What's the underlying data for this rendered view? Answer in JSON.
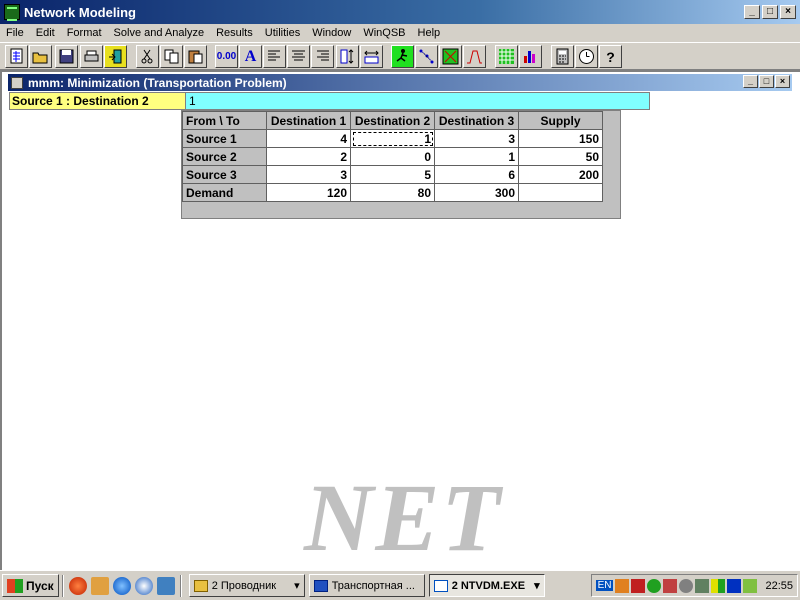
{
  "app": {
    "title": "Network Modeling"
  },
  "menu": [
    "File",
    "Edit",
    "Format",
    "Solve and Analyze",
    "Results",
    "Utilities",
    "Window",
    "WinQSB",
    "Help"
  ],
  "toolbar": {
    "icons": [
      "new-problem-icon",
      "open-icon",
      "save-icon",
      "print-icon",
      "exit-icon",
      "cut-icon",
      "copy-icon",
      "paste-icon",
      "number-format-icon",
      "font-icon",
      "align-left-icon",
      "align-center-icon",
      "align-right-icon",
      "row-height-icon",
      "column-width-icon",
      "solve-icon",
      "graph-network-icon",
      "matrix-form-icon",
      "chart-icon",
      "grid-icon",
      "bar-chart-icon",
      "calculator-icon",
      "clock-icon",
      "help-icon"
    ],
    "zero_label": "0.00",
    "font_label": "A"
  },
  "child": {
    "title": "mmm: Minimization (Transportation Problem)"
  },
  "cell_ref": "Source 1 : Destination 2",
  "cell_value": "1",
  "grid": {
    "corner": "From \\ To",
    "columns": [
      "Destination 1",
      "Destination 2",
      "Destination 3",
      "Supply"
    ],
    "rows": [
      {
        "label": "Source 1",
        "values": [
          "4",
          "1",
          "3",
          "150"
        ]
      },
      {
        "label": "Source 2",
        "values": [
          "2",
          "0",
          "1",
          "50"
        ]
      },
      {
        "label": "Source 3",
        "values": [
          "3",
          "5",
          "6",
          "200"
        ]
      },
      {
        "label": "Demand",
        "values": [
          "120",
          "80",
          "300",
          ""
        ]
      }
    ]
  },
  "watermark": "NET",
  "taskbar": {
    "start_label": "Пуск",
    "buttons": [
      "2 Проводник",
      "Транспортная ...",
      "2 NTVDM.EXE"
    ],
    "lang": "EN",
    "clock": "22:55"
  }
}
